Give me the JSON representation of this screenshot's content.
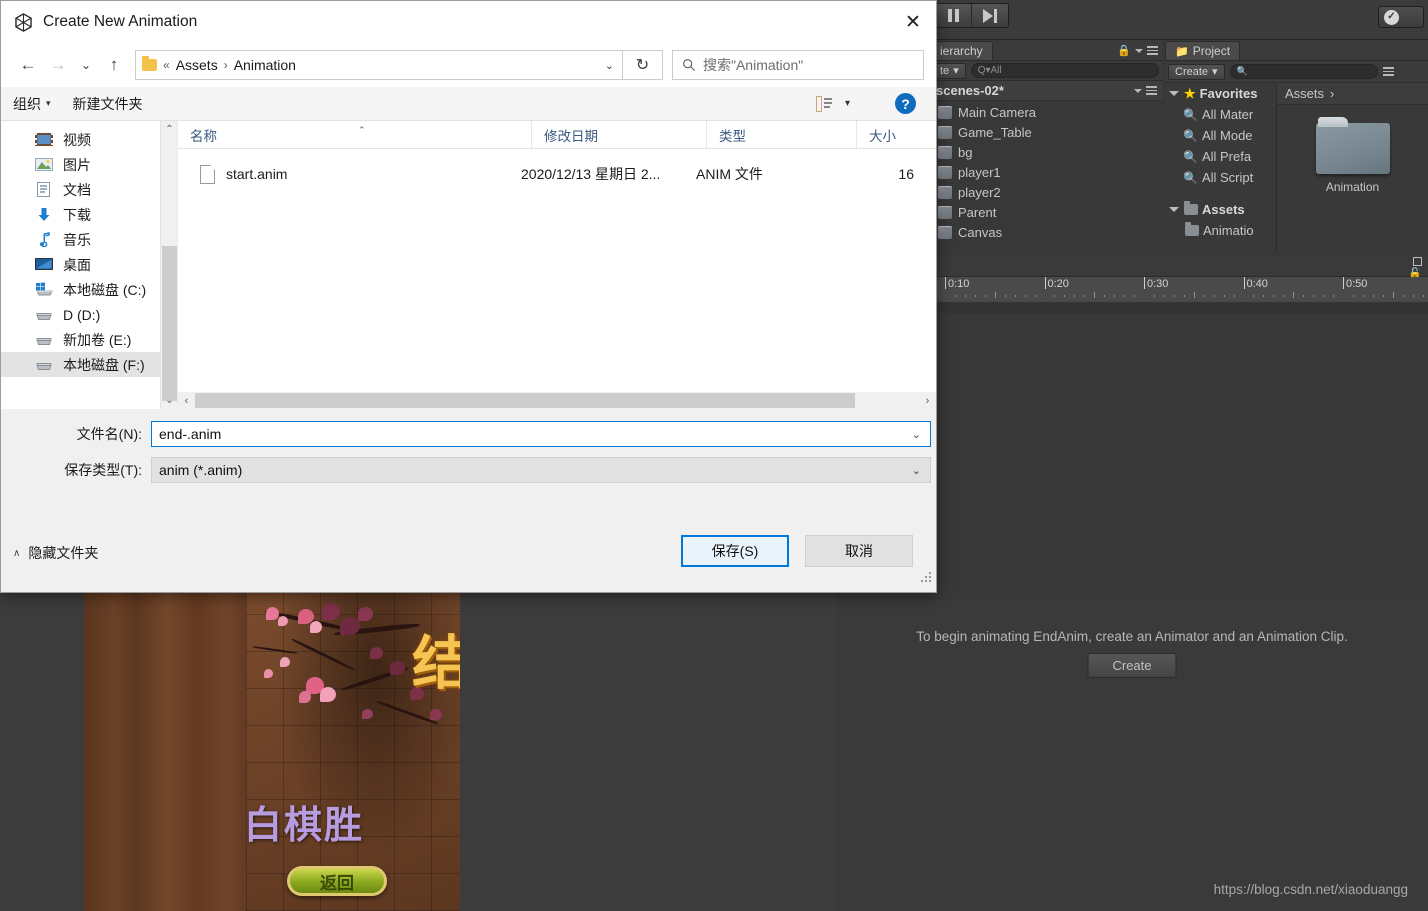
{
  "dialog": {
    "title": "Create New Animation",
    "close_label": "✕",
    "nav": {
      "back": "←",
      "forward": "→",
      "recent": "⌄",
      "up": "↑",
      "refresh": "↻",
      "address_caret": "⌄",
      "breadcrumb_prefix": "«",
      "breadcrumb": [
        "Assets",
        "Animation"
      ],
      "breadcrumb_sep": "›"
    },
    "search": {
      "placeholder": "搜索\"Animation\"",
      "icon": "search-icon"
    },
    "commands": {
      "organize": "组织",
      "organize_caret": "▾",
      "new_folder": "新建文件夹",
      "view_caret": "▾",
      "help": "?"
    },
    "nav_pane": {
      "items": [
        {
          "label": "视频",
          "icon": "videos-icon",
          "selected": false
        },
        {
          "label": "图片",
          "icon": "pictures-icon",
          "selected": false
        },
        {
          "label": "文档",
          "icon": "documents-icon",
          "selected": false
        },
        {
          "label": "下载",
          "icon": "downloads-icon",
          "selected": false
        },
        {
          "label": "音乐",
          "icon": "music-icon",
          "selected": false
        },
        {
          "label": "桌面",
          "icon": "desktop-icon",
          "selected": false
        },
        {
          "label": "本地磁盘 (C:)",
          "icon": "system-drive-icon",
          "selected": false
        },
        {
          "label": "D (D:)",
          "icon": "drive-icon",
          "selected": false
        },
        {
          "label": "新加卷 (E:)",
          "icon": "drive-icon",
          "selected": false
        },
        {
          "label": "本地磁盘 (F:)",
          "icon": "drive-icon",
          "selected": true
        }
      ],
      "scroll_up": "⌃",
      "scroll_down": "⌄"
    },
    "file_list": {
      "columns": [
        "名称",
        "修改日期",
        "类型",
        "大小"
      ],
      "sort_indicator": "⌃",
      "rows": [
        {
          "name": "start.anim",
          "modified": "2020/12/13 星期日 2...",
          "type": "ANIM 文件",
          "size": "16"
        }
      ],
      "hscroll_left": "‹",
      "hscroll_right": "›"
    },
    "fields": {
      "filename_label": "文件名(N):",
      "filename_value": "end-.anim",
      "filetype_label": "保存类型(T):",
      "filetype_value": "anim (*.anim)",
      "caret": "⌄"
    },
    "footer": {
      "hide_folders": "隐藏文件夹",
      "hide_folders_caret": "∧",
      "save": "保存(S)",
      "cancel": "取消"
    }
  },
  "unity": {
    "toolbar": {
      "pause": "pause-button",
      "step": "step-button",
      "collab_label": ""
    },
    "hierarchy": {
      "tab_label": "ierarchy",
      "create_label": "te",
      "create_caret": "▾",
      "search_placeholder": "Q▾All",
      "scene_name": "scenes-02*",
      "items": [
        "Main Camera",
        "Game_Table",
        "bg",
        "player1",
        "player2",
        "Parent",
        "Canvas"
      ]
    },
    "project": {
      "tab_label": "Project",
      "create_label": "Create",
      "create_caret": "▾",
      "search_placeholder": "",
      "tree": [
        {
          "label": "Favorites",
          "icon": "star-icon",
          "depth": 0,
          "bold": true
        },
        {
          "label": "All Mater",
          "icon": "search-icon",
          "depth": 1,
          "bold": false
        },
        {
          "label": "All Mode",
          "icon": "search-icon",
          "depth": 1,
          "bold": false
        },
        {
          "label": "All Prefa",
          "icon": "search-icon",
          "depth": 1,
          "bold": false
        },
        {
          "label": "All Script",
          "icon": "search-icon",
          "depth": 1,
          "bold": false
        },
        {
          "label": "Assets",
          "icon": "folder-icon",
          "depth": 0,
          "bold": true
        },
        {
          "label": "Animatio",
          "icon": "folder-icon",
          "depth": 1,
          "bold": false
        }
      ],
      "breadcrumb": "Assets",
      "breadcrumb_caret": "›",
      "asset_label": "Animation"
    },
    "timeline": {
      "labels": [
        "0:10",
        "0:20",
        "0:30",
        "0:40",
        "0:50"
      ]
    },
    "animation_window": {
      "message": "To begin animating EndAnim, create an Animator and an Animation Clip.",
      "create_button": "Create"
    },
    "watermark": "https://blog.csdn.net/xiaoduangg"
  },
  "game_view": {
    "end_char": "结",
    "result_text": "白棋胜",
    "back_button": "返回"
  },
  "colors": {
    "unity_bg": "#383838",
    "unity_panel": "#393939",
    "accent_blue": "#0078d7",
    "help_blue": "#0f6cbd",
    "folder_yellow": "#f3c24b",
    "favorites_yellow": "#ffd200"
  }
}
